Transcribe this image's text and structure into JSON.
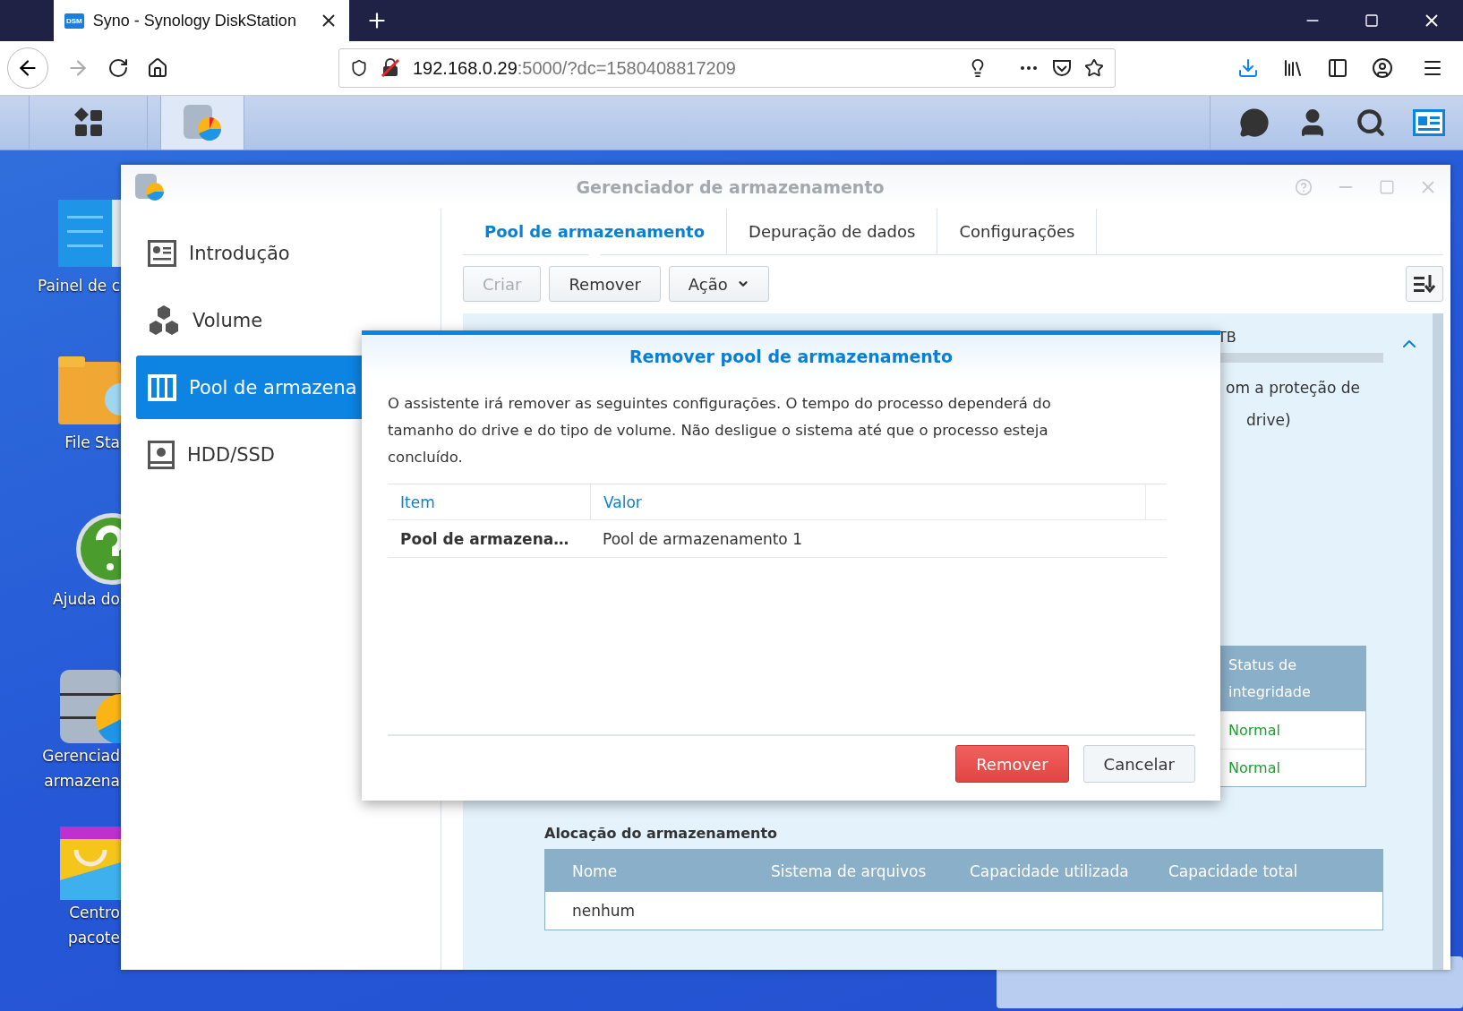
{
  "browser": {
    "tab_title": "Syno - Synology DiskStation",
    "favicon": "DSM",
    "url_host": "192.168.0.29",
    "url_rest": ":5000/?dc=1580408817209"
  },
  "desktop_icons": [
    {
      "kind": "panel",
      "lines": [
        "Painel de c"
      ]
    },
    {
      "kind": "folder",
      "lines": [
        "File Sta"
      ]
    },
    {
      "kind": "help",
      "lines": [
        "Ajuda do"
      ]
    },
    {
      "kind": "storage",
      "lines": [
        "Gerenciad",
        "armazena"
      ]
    },
    {
      "kind": "bag",
      "lines": [
        "Centro",
        "pacote"
      ]
    }
  ],
  "app_window": {
    "title": "Gerenciador de armazenamento",
    "sidebar": [
      {
        "kind": "intro",
        "label": "Introdução",
        "selected": false
      },
      {
        "kind": "volume",
        "label": "Volume",
        "selected": false
      },
      {
        "kind": "pool",
        "label": "Pool de armazena",
        "selected": true
      },
      {
        "kind": "disk",
        "label": "HDD/SSD",
        "selected": false
      }
    ],
    "tabs": [
      {
        "label": "Pool de armazenamento",
        "selected": true
      },
      {
        "label": "Depuração de dados",
        "selected": false
      },
      {
        "label": "Configurações",
        "selected": false
      }
    ],
    "toolbar": [
      {
        "label": "Criar",
        "disabled": true,
        "dropdown": false
      },
      {
        "label": "Remover",
        "disabled": false,
        "dropdown": false
      },
      {
        "label": "Ação",
        "disabled": false,
        "dropdown": true
      }
    ],
    "pool": {
      "usage": "TB",
      "expanded": true,
      "description_lines": [
        "om a proteção de",
        "drive)"
      ],
      "integrity": {
        "header": "Status de integridade",
        "rows": [
          "Normal",
          "Normal"
        ]
      },
      "allocation": {
        "title": "Alocação do armazenamento",
        "columns": [
          "Nome",
          "Sistema de arquivos",
          "Capacidade utilizada",
          "Capacidade total"
        ],
        "rows": [
          [
            "nenhum"
          ]
        ]
      }
    }
  },
  "dialog": {
    "title": "Remover pool de armazenamento",
    "message": "O assistente irá remover as seguintes configurações. O tempo do processo dependerá do tamanho do drive e do tipo de volume. Não desligue o sistema até que o processo esteja concluído.",
    "columns": [
      "Item",
      "Valor"
    ],
    "rows": [
      [
        "Pool de armazena…",
        "Pool de armazenamento 1"
      ]
    ],
    "buttons": [
      {
        "kind": "danger",
        "label": "Remover"
      },
      {
        "kind": "default",
        "label": "Cancelar"
      }
    ]
  }
}
